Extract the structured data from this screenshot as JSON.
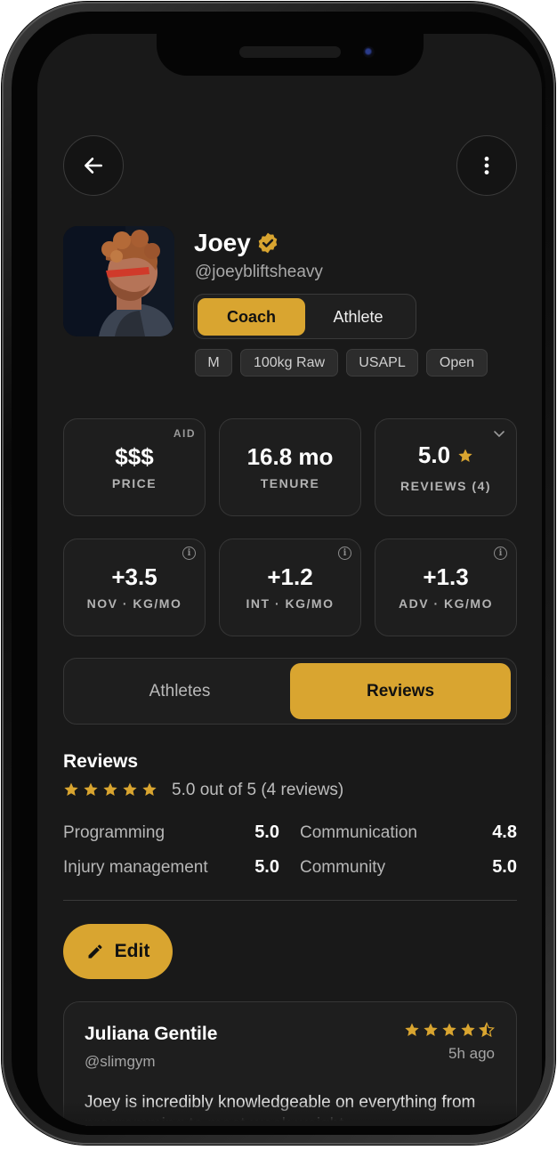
{
  "colors": {
    "accent": "#d9a530",
    "background": "#191919",
    "card": "#1e1e1e"
  },
  "header": {
    "back_icon": "arrow-left-icon",
    "menu_icon": "more-vertical-icon"
  },
  "profile": {
    "name": "Joey",
    "handle": "@joeybliftsheavy",
    "verified_icon": "verified-badge-icon",
    "role_toggle": {
      "options": [
        "Coach",
        "Athlete"
      ],
      "selected": "Coach"
    },
    "tags": [
      "M",
      "100kg Raw",
      "USAPL",
      "Open"
    ]
  },
  "stats": {
    "price": {
      "value": "$$$",
      "label": "PRICE",
      "corner": "AID"
    },
    "tenure": {
      "value": "16.8 mo",
      "label": "TENURE"
    },
    "reviews": {
      "value": "5.0",
      "label": "REVIEWS (4)",
      "icon": "star-icon"
    },
    "nov": {
      "value": "+3.5",
      "label": "NOV · KG/MO"
    },
    "int": {
      "value": "+1.2",
      "label": "INT · KG/MO"
    },
    "adv": {
      "value": "+1.3",
      "label": "ADV · KG/MO"
    }
  },
  "tabs": {
    "items": [
      "Athletes",
      "Reviews"
    ],
    "active": "Reviews"
  },
  "reviews": {
    "title": "Reviews",
    "rating": 5.0,
    "summary": "5.0 out of 5 (4 reviews)",
    "categories": [
      {
        "label": "Programming",
        "value": "5.0"
      },
      {
        "label": "Communication",
        "value": "4.8"
      },
      {
        "label": "Injury management",
        "value": "5.0"
      },
      {
        "label": "Community",
        "value": "5.0"
      }
    ],
    "edit_label": "Edit",
    "items": [
      {
        "name": "Juliana Gentile",
        "handle": "@slimgym",
        "rating": 4.5,
        "time": "5h ago",
        "body": "Joey is incredibly knowledgeable on everything from programming to meet-week weight"
      }
    ]
  }
}
